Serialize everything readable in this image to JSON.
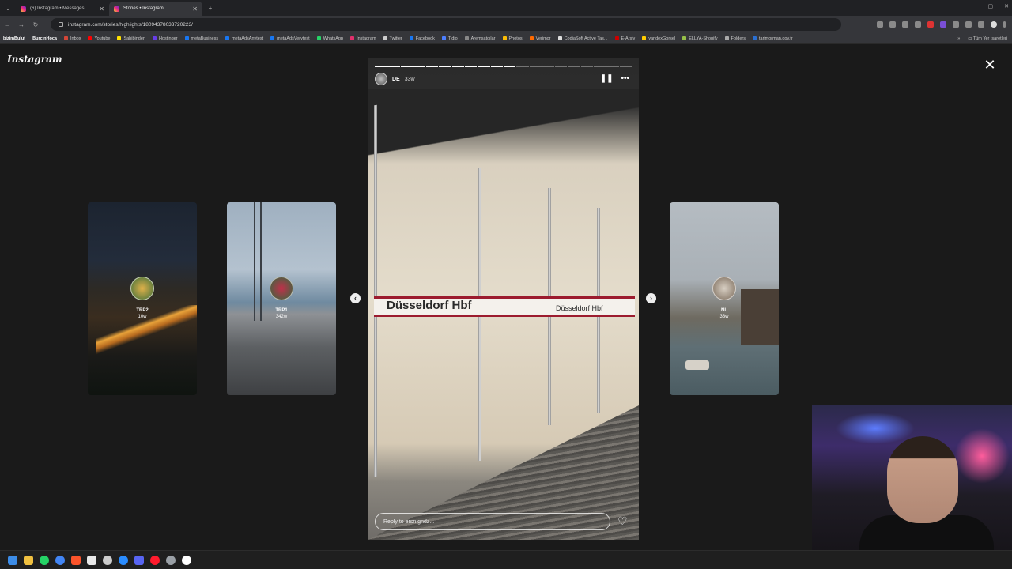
{
  "browser": {
    "tabs": [
      {
        "label": "(6) Instagram • Messages"
      },
      {
        "label": "Stories • Instagram"
      }
    ],
    "url": "instagram.com/stories/highlights/18094378033720223/",
    "bookmarks": [
      {
        "label": "bizimBulut",
        "color": "#ffffff"
      },
      {
        "label": "BurcinHoca",
        "color": "#ffffff"
      },
      {
        "label": "Inbox",
        "color": "#d44638"
      },
      {
        "label": "Youtube",
        "color": "#ff0000"
      },
      {
        "label": "Sahibinden",
        "color": "#ffe000"
      },
      {
        "label": "Hostinger",
        "color": "#673de6"
      },
      {
        "label": "metaBusiness",
        "color": "#1877f2"
      },
      {
        "label": "metaAdsAnytest",
        "color": "#1877f2"
      },
      {
        "label": "metaAdsVerytest",
        "color": "#1877f2"
      },
      {
        "label": "WhatsApp",
        "color": "#25d366"
      },
      {
        "label": "Instagram",
        "color": "#e1306c"
      },
      {
        "label": "Twitter",
        "color": "#cccccc"
      },
      {
        "label": "Facebook",
        "color": "#1877f2"
      },
      {
        "label": "Tidio",
        "color": "#4c7fff"
      },
      {
        "label": "Aremsatcılar",
        "color": "#888888"
      },
      {
        "label": "Photos",
        "color": "#fbbc04"
      },
      {
        "label": "Verimor",
        "color": "#ff6a00"
      },
      {
        "label": "CodiaSoft Active Tas...",
        "color": "#dddddd"
      },
      {
        "label": "E-Arşiv",
        "color": "#cc0000"
      },
      {
        "label": "yandexGorsel",
        "color": "#ffcc00"
      },
      {
        "label": "ELLYA-Shopify",
        "color": "#96bf48"
      },
      {
        "label": "Folders",
        "color": "#aaaaaa"
      },
      {
        "label": "tarimorman.gov.tr",
        "color": "#2a6fd1"
      }
    ],
    "bookmarks_right": "Tüm Yer İşaretleri"
  },
  "instagram": {
    "logo": "Instagram",
    "side_stories": [
      {
        "name": "TRP2",
        "time": "10w"
      },
      {
        "name": "TRP1",
        "time": "342w"
      },
      {
        "name": "NL",
        "time": "33w"
      }
    ],
    "story": {
      "username": "DE",
      "time": "33w",
      "sign_text": "Düsseldorf Hbf",
      "sign_text_small": "Düsseldorf Hbf",
      "reply_placeholder": "Reply to ersn.gndz...",
      "progress_total": 20,
      "progress_done": 11
    }
  }
}
